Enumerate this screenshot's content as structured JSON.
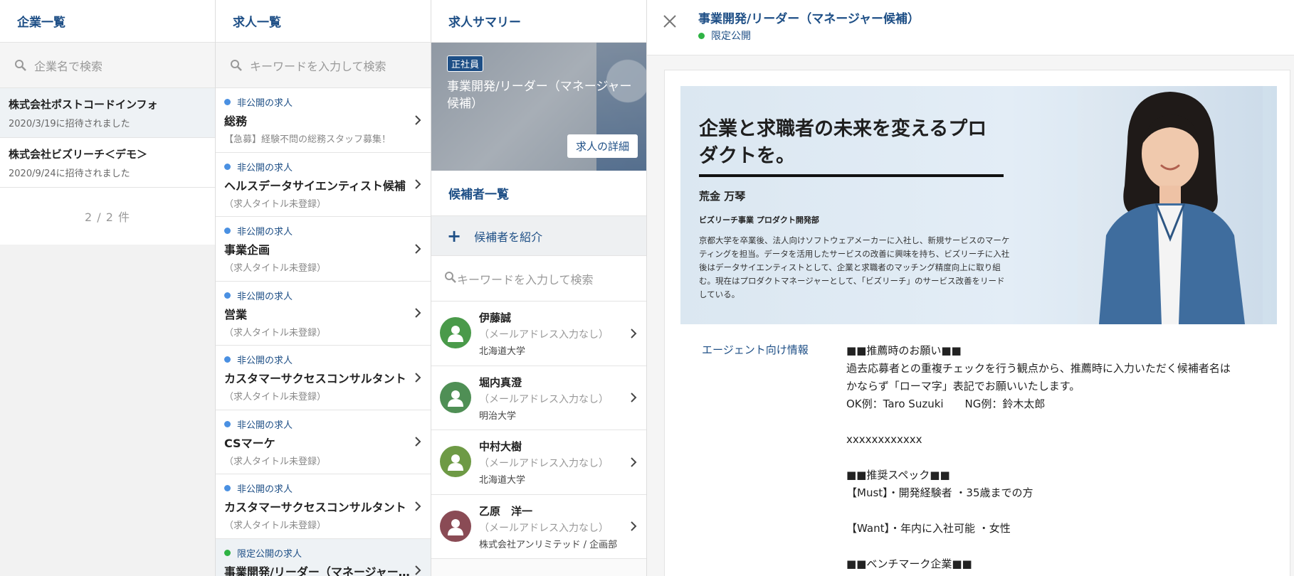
{
  "companies": {
    "header": "企業一覧",
    "search_placeholder": "企業名で検索",
    "items": [
      {
        "name": "株式会社ポストコードインフォ",
        "invited": "2020/3/19に招待されました"
      },
      {
        "name": "株式会社ビズリーチ＜デモ＞",
        "invited": "2020/9/24に招待されました"
      }
    ],
    "count": "2 / 2 件"
  },
  "jobs": {
    "header": "求人一覧",
    "search_placeholder": "キーワードを入力して検索",
    "items": [
      {
        "status": "非公開の求人",
        "title": "総務",
        "sub": "【急募】経験不問の総務スタッフ募集！"
      },
      {
        "status": "非公開の求人",
        "title": "ヘルスデータサイエンティスト候補",
        "sub": "（求人タイトル未登録）"
      },
      {
        "status": "非公開の求人",
        "title": "事業企画",
        "sub": "（求人タイトル未登録）"
      },
      {
        "status": "非公開の求人",
        "title": "営業",
        "sub": "（求人タイトル未登録）"
      },
      {
        "status": "非公開の求人",
        "title": "カスタマーサクセスコンサルタント",
        "sub": "（求人タイトル未登録）"
      },
      {
        "status": "非公開の求人",
        "title": "CSマーケ",
        "sub": "（求人タイトル未登録）"
      },
      {
        "status": "非公開の求人",
        "title": "カスタマーサクセスコンサルタント",
        "sub": "（求人タイトル未登録）"
      },
      {
        "status": "限定公開の求人",
        "title": "事業開発/リーダー（マネージャー候補）",
        "sub": ""
      }
    ]
  },
  "summary": {
    "header": "求人サマリー",
    "badge": "正社員",
    "title": "事業開発/リーダー（マネージャー候補）",
    "detail_button": "求人の詳細",
    "candidates_header": "候補者一覧",
    "add_candidate": "候補者を紹介",
    "search_placeholder": "キーワードを入力して検索",
    "candidates": [
      {
        "name": "伊藤誠",
        "email": "（メールアドレス入力なし）",
        "school": "北海道大学",
        "color": "#4a9a4a"
      },
      {
        "name": "堀内真澄",
        "email": "（メールアドレス入力なし）",
        "school": "明治大学",
        "color": "#4f8f55"
      },
      {
        "name": "中村大樹",
        "email": "（メールアドレス入力なし）",
        "school": "北海道大学",
        "color": "#6e9a45"
      },
      {
        "name": "乙原　洋一",
        "email": "（メールアドレス入力なし）",
        "school": "株式会社アンリミテッド / 企画部",
        "color": "#8a4b55"
      }
    ]
  },
  "detail": {
    "title": "事業開発/リーダー（マネージャー候補）",
    "status": "限定公開",
    "hero": {
      "heading": "企業と求職者の未来を変えるプロダクトを。",
      "name": "荒金 万琴",
      "dept": "ビズリーチ事業 プロダクト開発部",
      "bio": "京都大学を卒業後、法人向けソフトウェアメーカーに入社し、新規サービスのマーケティングを担当。データを活用したサービスの改善に興味を持ち、ビズリーチに入社後はデータサイエンティストとして、企業と求職者のマッチング精度向上に取り組む。現在はプロダクトマネージャーとして、「ビズリーチ」のサービス改善をリードしている。"
    },
    "agent_label": "エージェント向け情報",
    "agent_body": "■■推薦時のお願い■■\n過去応募者との重複チェックを行う観点から、推薦時に入力いただく候補者名は\nかならず「ローマ字」表記でお願いいたします。\nOK例：Taro Suzuki　　NG例：鈴木太郎\n\nxxxxxxxxxxxx\n\n■■推奨スペック■■\n【Must】・開発経験者 ・35歳までの方\n\n【Want】・年内に入社可能 ・女性\n\n■■ベンチマーク企業■■"
  },
  "colors": {
    "accent": "#1e4f86",
    "private_dot": "#4a90e2",
    "limited_dot": "#2fb344"
  }
}
